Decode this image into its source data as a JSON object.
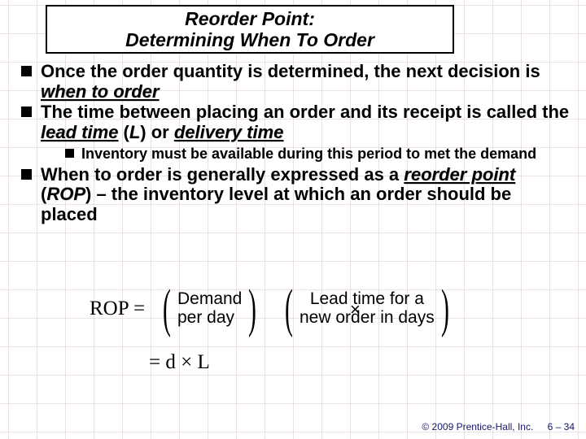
{
  "title": {
    "line1": "Reorder Point:",
    "line2": "Determining When To Order"
  },
  "bullets": {
    "b1_a": "Once the order quantity is determined, the next decision is ",
    "b1_kw": "when to order",
    "b2_a": "The time between placing an order and its receipt is called the ",
    "b2_kw1": "lead time",
    "b2_mid": " (",
    "b2_L": "L",
    "b2_mid2": ") or ",
    "b2_kw2": "delivery time",
    "sub1": "Inventory must be available during this period to met the demand",
    "b3_a": "When to order is generally expressed as a ",
    "b3_kw": "reorder point",
    "b3_mid": " (",
    "b3_rop": "ROP",
    "b3_tail": ") – the inventory level at which an order should be placed"
  },
  "formula": {
    "rop": "ROP",
    "eq": "=",
    "group1_l1": "Demand",
    "group1_l2": "per day",
    "times": "×",
    "group2_l1": "Lead time for a",
    "group2_l2": "new order in days",
    "dl": "= d × L"
  },
  "footer": {
    "copyright": "© 2009 Prentice-Hall, Inc.",
    "page": "6 – 34"
  }
}
